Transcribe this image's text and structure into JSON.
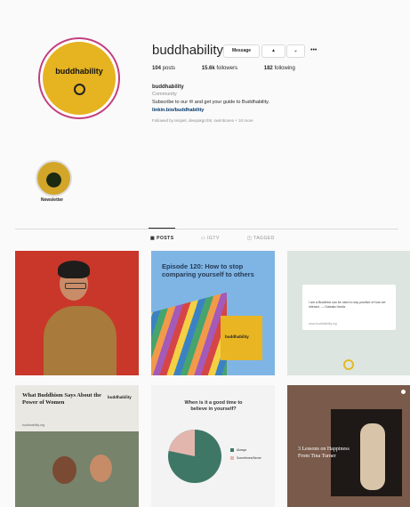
{
  "profile": {
    "avatar_text": "buddhability",
    "username": "buddhability",
    "buttons": {
      "message": "Message",
      "follow": "▲",
      "dropdown": "⌄",
      "more": "•••"
    },
    "stats": {
      "posts_count": "104",
      "posts_label": "posts",
      "followers_count": "15.6k",
      "followers_label": "followers",
      "following_count": "182",
      "following_label": "following"
    },
    "bio": {
      "name": "buddhability",
      "category": "Community",
      "line": "Subscribe to our ✉ and get your guide to Buddhability.",
      "link": "linkin.bio/buddhability",
      "followed_by": "Followed by tenpiel, deepakgrch8, swimbones + 34 more"
    }
  },
  "highlight": {
    "label": "Newsletter"
  },
  "tabs": [
    {
      "label": "POSTS"
    },
    {
      "label": "IGTV"
    },
    {
      "label": "TAGGED"
    }
  ],
  "posts": [
    {
      "title": ""
    },
    {
      "title": "Episode 120: How to stop comparing yourself to others",
      "brand": "buddhability"
    },
    {
      "card_text": "I am a Buddhist can be used to say positive of how we interact. — Daisaku Ikeda",
      "card_url": "www.buddhability.org"
    },
    {
      "title": "What Buddhism Says About the Power of Women",
      "brand": "buddhability",
      "byline": "buddhability.org"
    },
    {
      "question": "When is it a good time to believe in yourself?",
      "legend": [
        "Always",
        "Sometimes/Never"
      ]
    },
    {
      "title": "3 Lessons on Happiness From Tina Turner"
    }
  ],
  "colors": {
    "yellow": "#e6b321",
    "pink_ring": "#c23f7d",
    "link": "#00376b",
    "pie_green": "#3f7767",
    "pie_pink": "#e3b6ad"
  }
}
